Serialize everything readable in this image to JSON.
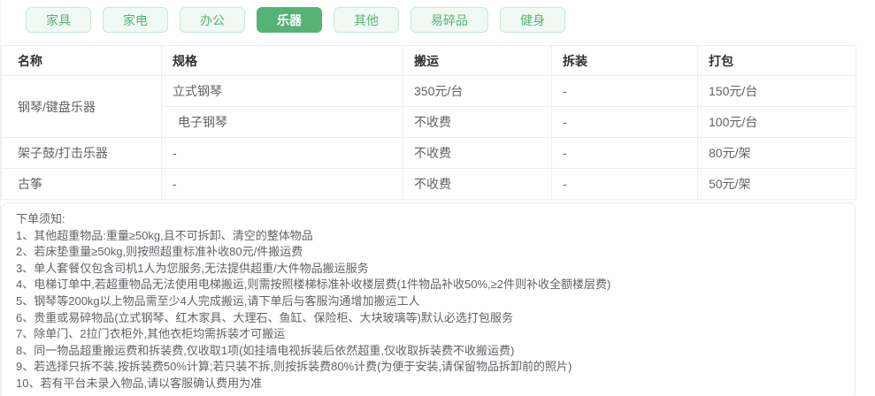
{
  "tabs": {
    "items": [
      {
        "label": "家具",
        "active": false
      },
      {
        "label": "家电",
        "active": false
      },
      {
        "label": "办公",
        "active": false
      },
      {
        "label": "乐器",
        "active": true
      },
      {
        "label": "其他",
        "active": false
      },
      {
        "label": "易碎品",
        "active": false
      },
      {
        "label": "健身",
        "active": false
      }
    ]
  },
  "pricing_table": {
    "headers": [
      "名称",
      "规格",
      "搬运",
      "拆装",
      "打包"
    ],
    "rows": [
      {
        "name": "钢琴/键盘乐器",
        "spec": "立式钢琴",
        "moving": "350元/台",
        "disassembly": "-",
        "packing": "150元/台"
      },
      {
        "spec": "电子钢琴",
        "moving": "不收费",
        "disassembly": "-",
        "packing": "100元/台"
      },
      {
        "name": "架子鼓/打击乐器",
        "spec": "-",
        "moving": "不收费",
        "disassembly": "-",
        "packing": "80元/架"
      },
      {
        "name": "古筝",
        "spec": "-",
        "moving": "不收费",
        "disassembly": "-",
        "packing": "50元/架"
      }
    ]
  },
  "notes": {
    "title": "下单须知:",
    "items": [
      "1、其他超重物品:重量≥50kg,且不可拆卸、清空的整体物品",
      "2、若床垫重量≥50kg,则按照超重标准补收80元/件搬运费",
      "3、单人套餐仅包含司机1人为您服务,无法提供超重/大件物品搬运服务",
      "4、电梯订单中,若超重物品无法使用电梯搬运,则需按照楼梯标准补收楼层费(1件物品补收50%,≥2件则补收全额楼层费)",
      "5、钢琴等200kg以上物品需至少4人完成搬运,请下单后与客服沟通增加搬运工人",
      "6、贵重或易碎物品(立式钢琴、红木家具、大理石、鱼缸、保险柜、大块玻璃等)默认必选打包服务",
      "7、除单门、2拉门衣柜外,其他衣柜均需拆装才可搬运",
      "8、同一物品超重搬运费和拆装费,仅收取1项(如挂墙电视拆装后依然超重,仅收取拆装费不收搬运费)",
      "9、若选择只拆不装,按拆装费50%计算;若只装不拆,则按拆装费80%计费(为便于安装,请保留物品拆卸前的照片)",
      "10、若有平台未录入物品,请以客服确认费用为准"
    ]
  },
  "colors": {
    "accent_green": "#56b377",
    "tab_inactive_bg": "#f0f9f3",
    "tab_inactive_border": "#cbe8d6",
    "table_border": "#e9f1ec",
    "header_text": "#303133",
    "body_text": "#5f6367"
  }
}
